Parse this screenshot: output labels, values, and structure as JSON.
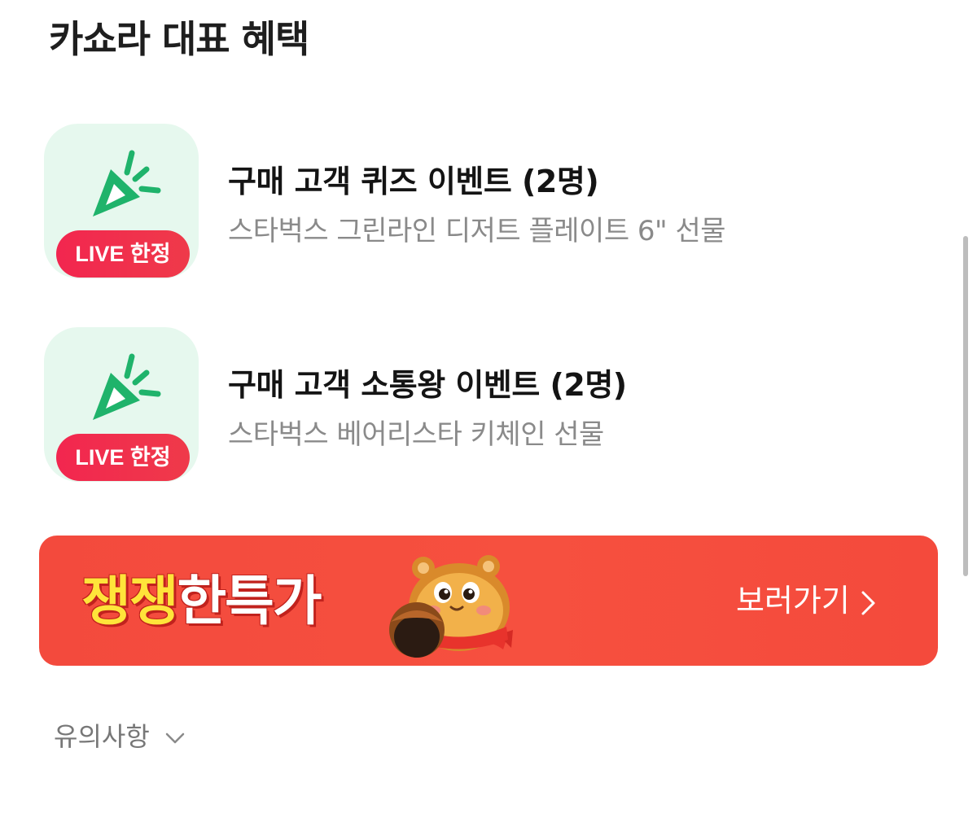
{
  "section": {
    "title": "카쇼라 대표 혜택"
  },
  "benefits": [
    {
      "badge": "LIVE 한정",
      "title": "구매 고객 퀴즈 이벤트 (2명)",
      "description": "스타벅스 그린라인 디저트 플레이트 6\" 선물",
      "icon": "party-popper-icon"
    },
    {
      "badge": "LIVE 한정",
      "title": "구매 고객 소통왕 이벤트 (2명)",
      "description": "스타벅스 베어리스타 키체인 선물",
      "icon": "party-popper-icon"
    }
  ],
  "banner": {
    "text_yellow": "쟁쟁",
    "text_white": "한특가",
    "cta": "보러가기",
    "icon": "chevron-right-icon",
    "mascot": "squirrel-mascot"
  },
  "notice": {
    "label": "유의사항",
    "icon": "chevron-down-icon"
  },
  "colors": {
    "title_text": "#1e1e1e",
    "desc_text": "#8a8a8a",
    "thumb_bg": "#e6f8ee",
    "icon_green": "#1fb36b",
    "badge_red": "#f2264f",
    "banner_red": "#f34a3d",
    "banner_yellow": "#ffe43a"
  }
}
